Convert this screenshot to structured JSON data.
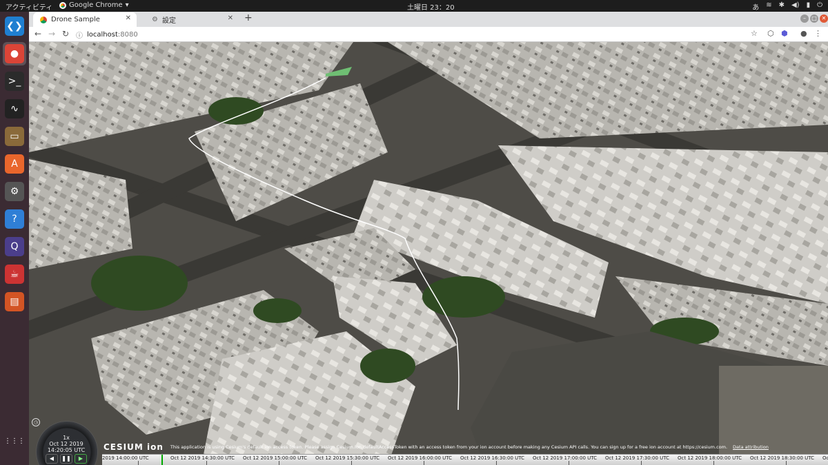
{
  "topbar": {
    "activities": "アクティビティ",
    "app_name": "Google Chrome",
    "clock": "土曜日 23：20",
    "tray_lang": "あ"
  },
  "dock": {
    "items": [
      {
        "name": "vscode-icon",
        "glyph": "❮❯",
        "color": "#1f7fd1"
      },
      {
        "name": "chrome-icon",
        "glyph": "●",
        "color": "#db4437"
      },
      {
        "name": "terminal-icon",
        "glyph": ">_",
        "color": "#2b2b2b"
      },
      {
        "name": "system-monitor-icon",
        "glyph": "∿",
        "color": "#222"
      },
      {
        "name": "files-icon",
        "glyph": "▭",
        "color": "#8a6a3a"
      },
      {
        "name": "software-center-icon",
        "glyph": "A",
        "color": "#e9662c"
      },
      {
        "name": "settings-icon",
        "glyph": "⚙",
        "color": "#555"
      },
      {
        "name": "help-icon",
        "glyph": "?",
        "color": "#2f7fd6"
      },
      {
        "name": "qgis-icon",
        "glyph": "Q",
        "color": "#4b3e8b"
      },
      {
        "name": "java-icon",
        "glyph": "☕",
        "color": "#c33"
      },
      {
        "name": "presentation-icon",
        "glyph": "▤",
        "color": "#d35424"
      },
      {
        "name": "app-grid-icon",
        "glyph": "⋮⋮⋮",
        "color": "transparent"
      }
    ]
  },
  "browser": {
    "tabs": [
      {
        "label": "Drone Sample",
        "active": true
      },
      {
        "label": "設定",
        "active": false
      }
    ],
    "url": "localhost:8080",
    "url_host": "localhost",
    "url_port": ":8080"
  },
  "cesium": {
    "logo": "CESIUM ion",
    "credit_message": "This application is using Cesium's default ion access token. Please assign Cesium.Ion.defaultAccessToken with an access token from your ion account before making any Cesium API calls. You can sign up for a free ion account at https://cesium.com.",
    "credit_link": "Data attribution",
    "clock": {
      "speed": "1x",
      "date": "Oct 12 2019",
      "time": "14:20:05 UTC"
    },
    "timeline_labels": [
      "2019 14:00:00 UTC",
      "Oct 12 2019 14:30:00 UTC",
      "Oct 12 2019 15:00:00 UTC",
      "Oct 12 2019 15:30:00 UTC",
      "Oct 12 2019 16:00:00 UTC",
      "Oct 12 2019 16:30:00 UTC",
      "Oct 12 2019 17:00:00 UTC",
      "Oct 12 2019 17:30:00 UTC",
      "Oct 12 2019 18:00:00 UTC",
      "Oct 12 2019 18:30:00 UTC",
      "Oct"
    ]
  }
}
